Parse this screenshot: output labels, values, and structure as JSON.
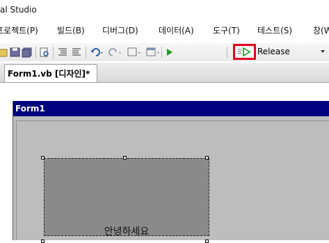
{
  "window": {
    "title": "al Studio"
  },
  "menu": {
    "items": [
      {
        "label": "프로젝트(P)"
      },
      {
        "label": "빌드(B)"
      },
      {
        "label": "디버그(D)"
      },
      {
        "label": "데이터(A)"
      },
      {
        "label": "도구(T)"
      },
      {
        "label": "테스트(S)"
      },
      {
        "label": "창(W"
      }
    ]
  },
  "toolbar": {
    "configuration": "Release",
    "icons": [
      "open-icon",
      "save-icon",
      "save-all-icon",
      "find-icon",
      "indent-icon",
      "outdent-icon",
      "undo-icon",
      "redo-icon",
      "layout-icon",
      "window-icon",
      "start-debugging-icon",
      "start-without-debugging-icon"
    ]
  },
  "tabs": [
    {
      "label": "Form1.vb [디자인]*"
    }
  ],
  "designer": {
    "form_title": "Form1",
    "label_text": "안녕하세요"
  }
}
